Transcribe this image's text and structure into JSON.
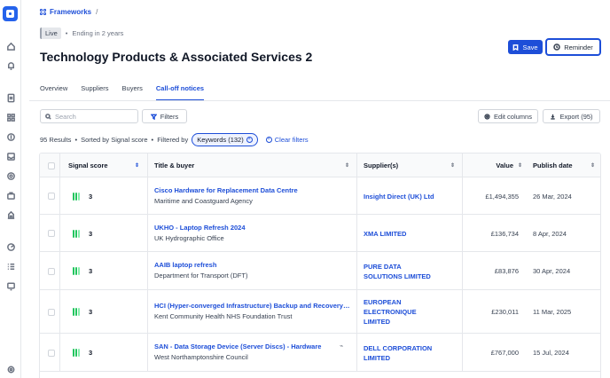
{
  "breadcrumb": {
    "frameworks": "Frameworks",
    "separator": "/"
  },
  "status": {
    "badge": "Live",
    "ending": "Ending in 2 years"
  },
  "page_title": "Technology Products & Associated Services 2",
  "actions": {
    "save": "Save",
    "reminder": "Reminder"
  },
  "tabs": [
    "Overview",
    "Suppliers",
    "Buyers",
    "Call-off notices"
  ],
  "active_tab": "Call-off notices",
  "toolbar": {
    "search_placeholder": "Search",
    "filters": "Filters",
    "edit_columns": "Edit columns",
    "export": "Export (95)"
  },
  "results": {
    "count": "95 Results",
    "sorted": "Sorted by Signal score",
    "filtered_by": "Filtered by",
    "keyword_chip": "Keywords (132)",
    "clear": "Clear filters"
  },
  "table": {
    "headers": {
      "signal": "Signal score",
      "title": "Title & buyer",
      "suppliers": "Supplier(s)",
      "value": "Value",
      "date": "Publish date"
    },
    "rows": [
      {
        "score": "3",
        "title": "Cisco Hardware for Replacement Data Centre",
        "buyer": "Maritime and Coastguard Agency",
        "supplier_lines": [
          "Insight Direct (UK) Ltd"
        ],
        "value": "£1,494,355",
        "date": "26 Mar, 2024"
      },
      {
        "score": "3",
        "title": "UKHO - Laptop Refresh 2024",
        "buyer": "UK Hydrographic Office",
        "supplier_lines": [
          "XMA LIMITED"
        ],
        "value": "£136,734",
        "date": "8 Apr, 2024"
      },
      {
        "score": "3",
        "title": "AAIB laptop refresh",
        "buyer": "Department for Transport (DFT)",
        "supplier_lines": [
          "PURE DATA",
          "SOLUTIONS LIMITED"
        ],
        "value": "£83,876",
        "date": "30 Apr, 2024"
      },
      {
        "score": "3",
        "title": "HCI (Hyper-converged Infrastructure) Backup and Recovery Sol...",
        "buyer": "Kent Community Health NHS Foundation Trust",
        "supplier_lines": [
          "EUROPEAN",
          "ELECTRONIQUE",
          "LIMITED"
        ],
        "value": "£230,011",
        "date": "11 Mar, 2025"
      },
      {
        "score": "3",
        "title": "SAN - Data Storage Device (Server Discs) - Hardware",
        "buyer": "West Northamptonshire Council",
        "supplier_lines": [
          "DELL CORPORATION",
          "LIMITED"
        ],
        "value": "£767,000",
        "date": "15 Jul, 2024"
      }
    ]
  },
  "colors": {
    "accent": "#1d4ed8",
    "signal_green": "#22c55e"
  }
}
